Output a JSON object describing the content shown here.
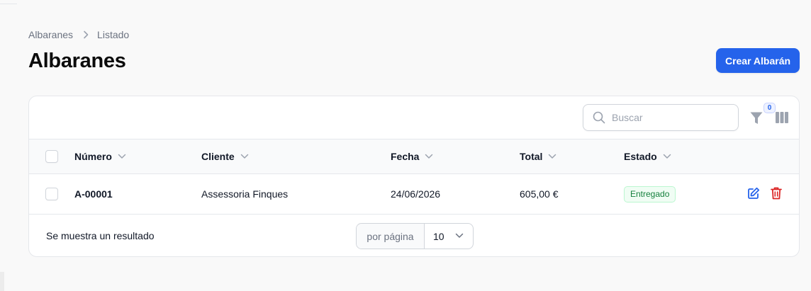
{
  "breadcrumb": {
    "items": [
      "Albaranes",
      "Listado"
    ]
  },
  "page": {
    "title": "Albaranes",
    "create_label": "Crear Albarán"
  },
  "toolbar": {
    "search_placeholder": "Buscar",
    "filter_count": "0"
  },
  "table": {
    "columns": [
      "Número",
      "Cliente",
      "Fecha",
      "Total",
      "Estado"
    ],
    "rows": [
      {
        "numero": "A-00001",
        "cliente": "Assessoria Finques",
        "fecha": "24/06/2026",
        "total": "605,00 €",
        "estado": "Entregado"
      }
    ]
  },
  "footer": {
    "summary": "Se muestra un resultado",
    "per_page_label": "por página",
    "per_page_value": "10"
  },
  "colors": {
    "primary": "#2563eb",
    "success_bg": "#f0fdf4",
    "success_text": "#15803d",
    "danger": "#dc2626"
  }
}
